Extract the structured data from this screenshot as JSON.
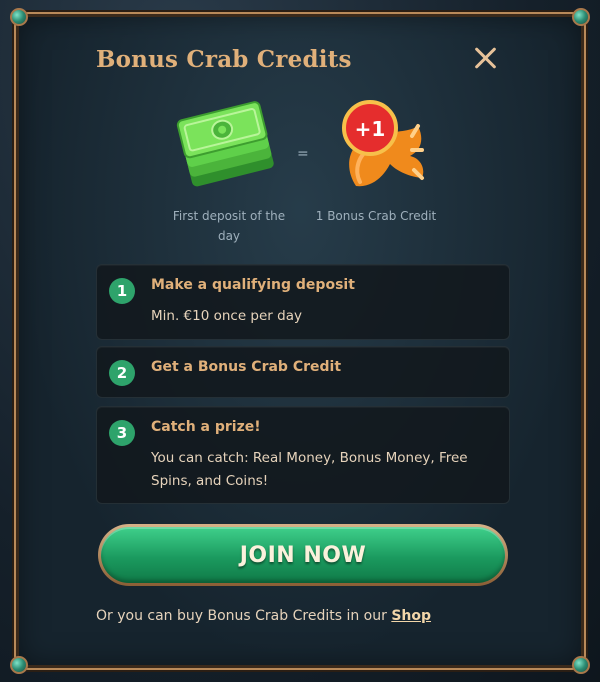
{
  "modal": {
    "title": "Bonus Crab Credits",
    "close_icon": "close-icon"
  },
  "equation": {
    "left_caption": "First deposit of the day",
    "sign": "=",
    "right_caption": "1 Bonus Crab Credit",
    "badge": "+1"
  },
  "steps": [
    {
      "number": "1",
      "title": "Make a qualifying deposit",
      "description": "Min. €10 once per day"
    },
    {
      "number": "2",
      "title": "Get a Bonus Crab Credit",
      "description": ""
    },
    {
      "number": "3",
      "title": "Catch a prize!",
      "description": "You can catch: Real Money, Bonus Money, Free Spins, and Coins!"
    }
  ],
  "join": {
    "label": "JOIN NOW"
  },
  "footer": {
    "text": "Or you can buy Bonus Crab Credits in our",
    "link_label": "Shop"
  },
  "colors": {
    "accent": "#e0b07a",
    "step_number": "#2ea36b",
    "button_green": "#1b9a5f"
  }
}
